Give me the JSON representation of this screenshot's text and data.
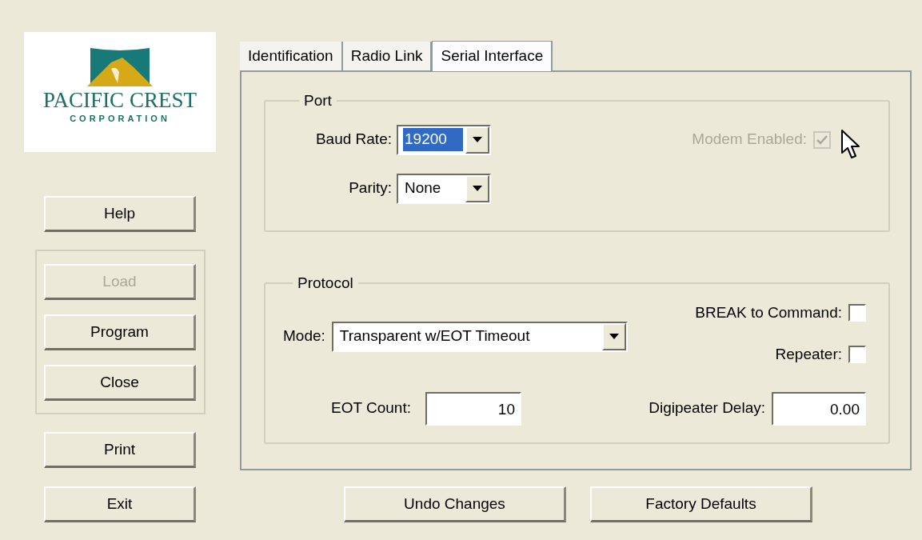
{
  "logo": {
    "name": "PACIFIC CREST",
    "subtitle": "CORPORATION"
  },
  "side_buttons": [
    {
      "label": "Help",
      "disabled": false
    }
  ],
  "group_buttons": [
    {
      "label": "Load",
      "disabled": true
    },
    {
      "label": "Program",
      "disabled": false
    },
    {
      "label": "Close",
      "disabled": false
    }
  ],
  "lower_buttons": [
    {
      "label": "Print",
      "disabled": false
    },
    {
      "label": "Exit",
      "disabled": false
    }
  ],
  "tabs": [
    {
      "label": "Identification",
      "selected": false
    },
    {
      "label": "Radio Link",
      "selected": false
    },
    {
      "label": "Serial Interface",
      "selected": true
    }
  ],
  "port": {
    "title": "Port",
    "baud_rate": {
      "label": "Baud Rate:",
      "value": "19200",
      "highlighted": true
    },
    "parity": {
      "label": "Parity:",
      "value": "None",
      "highlighted": false
    },
    "modem_enabled": {
      "label": "Modem Enabled:",
      "checked": true,
      "disabled": true
    }
  },
  "protocol": {
    "title": "Protocol",
    "mode": {
      "label": "Mode:",
      "value": "Transparent w/EOT Timeout",
      "highlighted": false
    },
    "break_to_command": {
      "label": "BREAK to Command:",
      "checked": false,
      "disabled": false
    },
    "repeater": {
      "label": "Repeater:",
      "checked": false,
      "disabled": false
    },
    "eot_count": {
      "label": "EOT Count:",
      "value": "10"
    },
    "digipeater_delay": {
      "label": "Digipeater Delay:",
      "value": "0.00"
    }
  },
  "actions": [
    {
      "label": "Undo Changes",
      "disabled": false
    },
    {
      "label": "Factory Defaults",
      "disabled": false
    }
  ]
}
